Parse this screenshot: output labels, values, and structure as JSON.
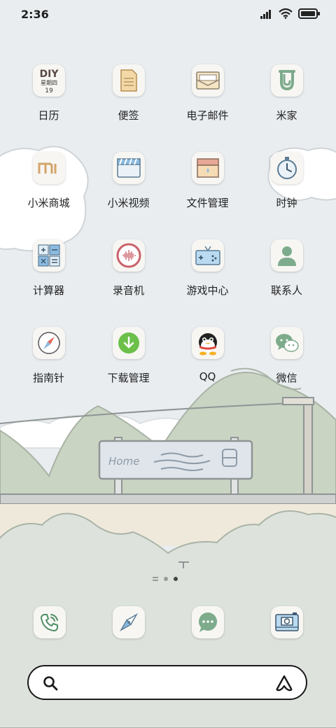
{
  "status_bar": {
    "time": "2:36"
  },
  "apps": [
    {
      "label": "日历",
      "icon": "calendar-icon",
      "icon_text": {
        "line1": "DIY",
        "line2": "星期四",
        "line3": "19"
      }
    },
    {
      "label": "便签",
      "icon": "notes-icon"
    },
    {
      "label": "电子邮件",
      "icon": "mail-icon"
    },
    {
      "label": "米家",
      "icon": "mijia-icon"
    },
    {
      "label": "小米商城",
      "icon": "mi-store-icon",
      "icon_text": "mi"
    },
    {
      "label": "小米视频",
      "icon": "video-clapper-icon"
    },
    {
      "label": "文件管理",
      "icon": "file-manager-icon"
    },
    {
      "label": "时钟",
      "icon": "clock-icon"
    },
    {
      "label": "计算器",
      "icon": "calculator-icon"
    },
    {
      "label": "录音机",
      "icon": "recorder-icon"
    },
    {
      "label": "游戏中心",
      "icon": "gamepad-icon"
    },
    {
      "label": "联系人",
      "icon": "contact-person-icon"
    },
    {
      "label": "指南针",
      "icon": "compass-icon"
    },
    {
      "label": "下载管理",
      "icon": "download-icon"
    },
    {
      "label": "QQ",
      "icon": "qq-penguin-icon"
    },
    {
      "label": "微信",
      "icon": "wechat-icon"
    }
  ],
  "wallpaper": {
    "sign_text": "Home"
  },
  "page_indicator": {
    "pages": 2,
    "current": 2
  },
  "dock": [
    {
      "icon": "phone-icon"
    },
    {
      "icon": "browser-compass-icon"
    },
    {
      "icon": "messages-icon"
    },
    {
      "icon": "camera-icon"
    }
  ],
  "search_bar": {
    "value": ""
  },
  "colors": {
    "background": "#e9edf0",
    "hill": "#c9d4c3",
    "ground": "#efe9dc",
    "bush": "#dde3dc"
  }
}
